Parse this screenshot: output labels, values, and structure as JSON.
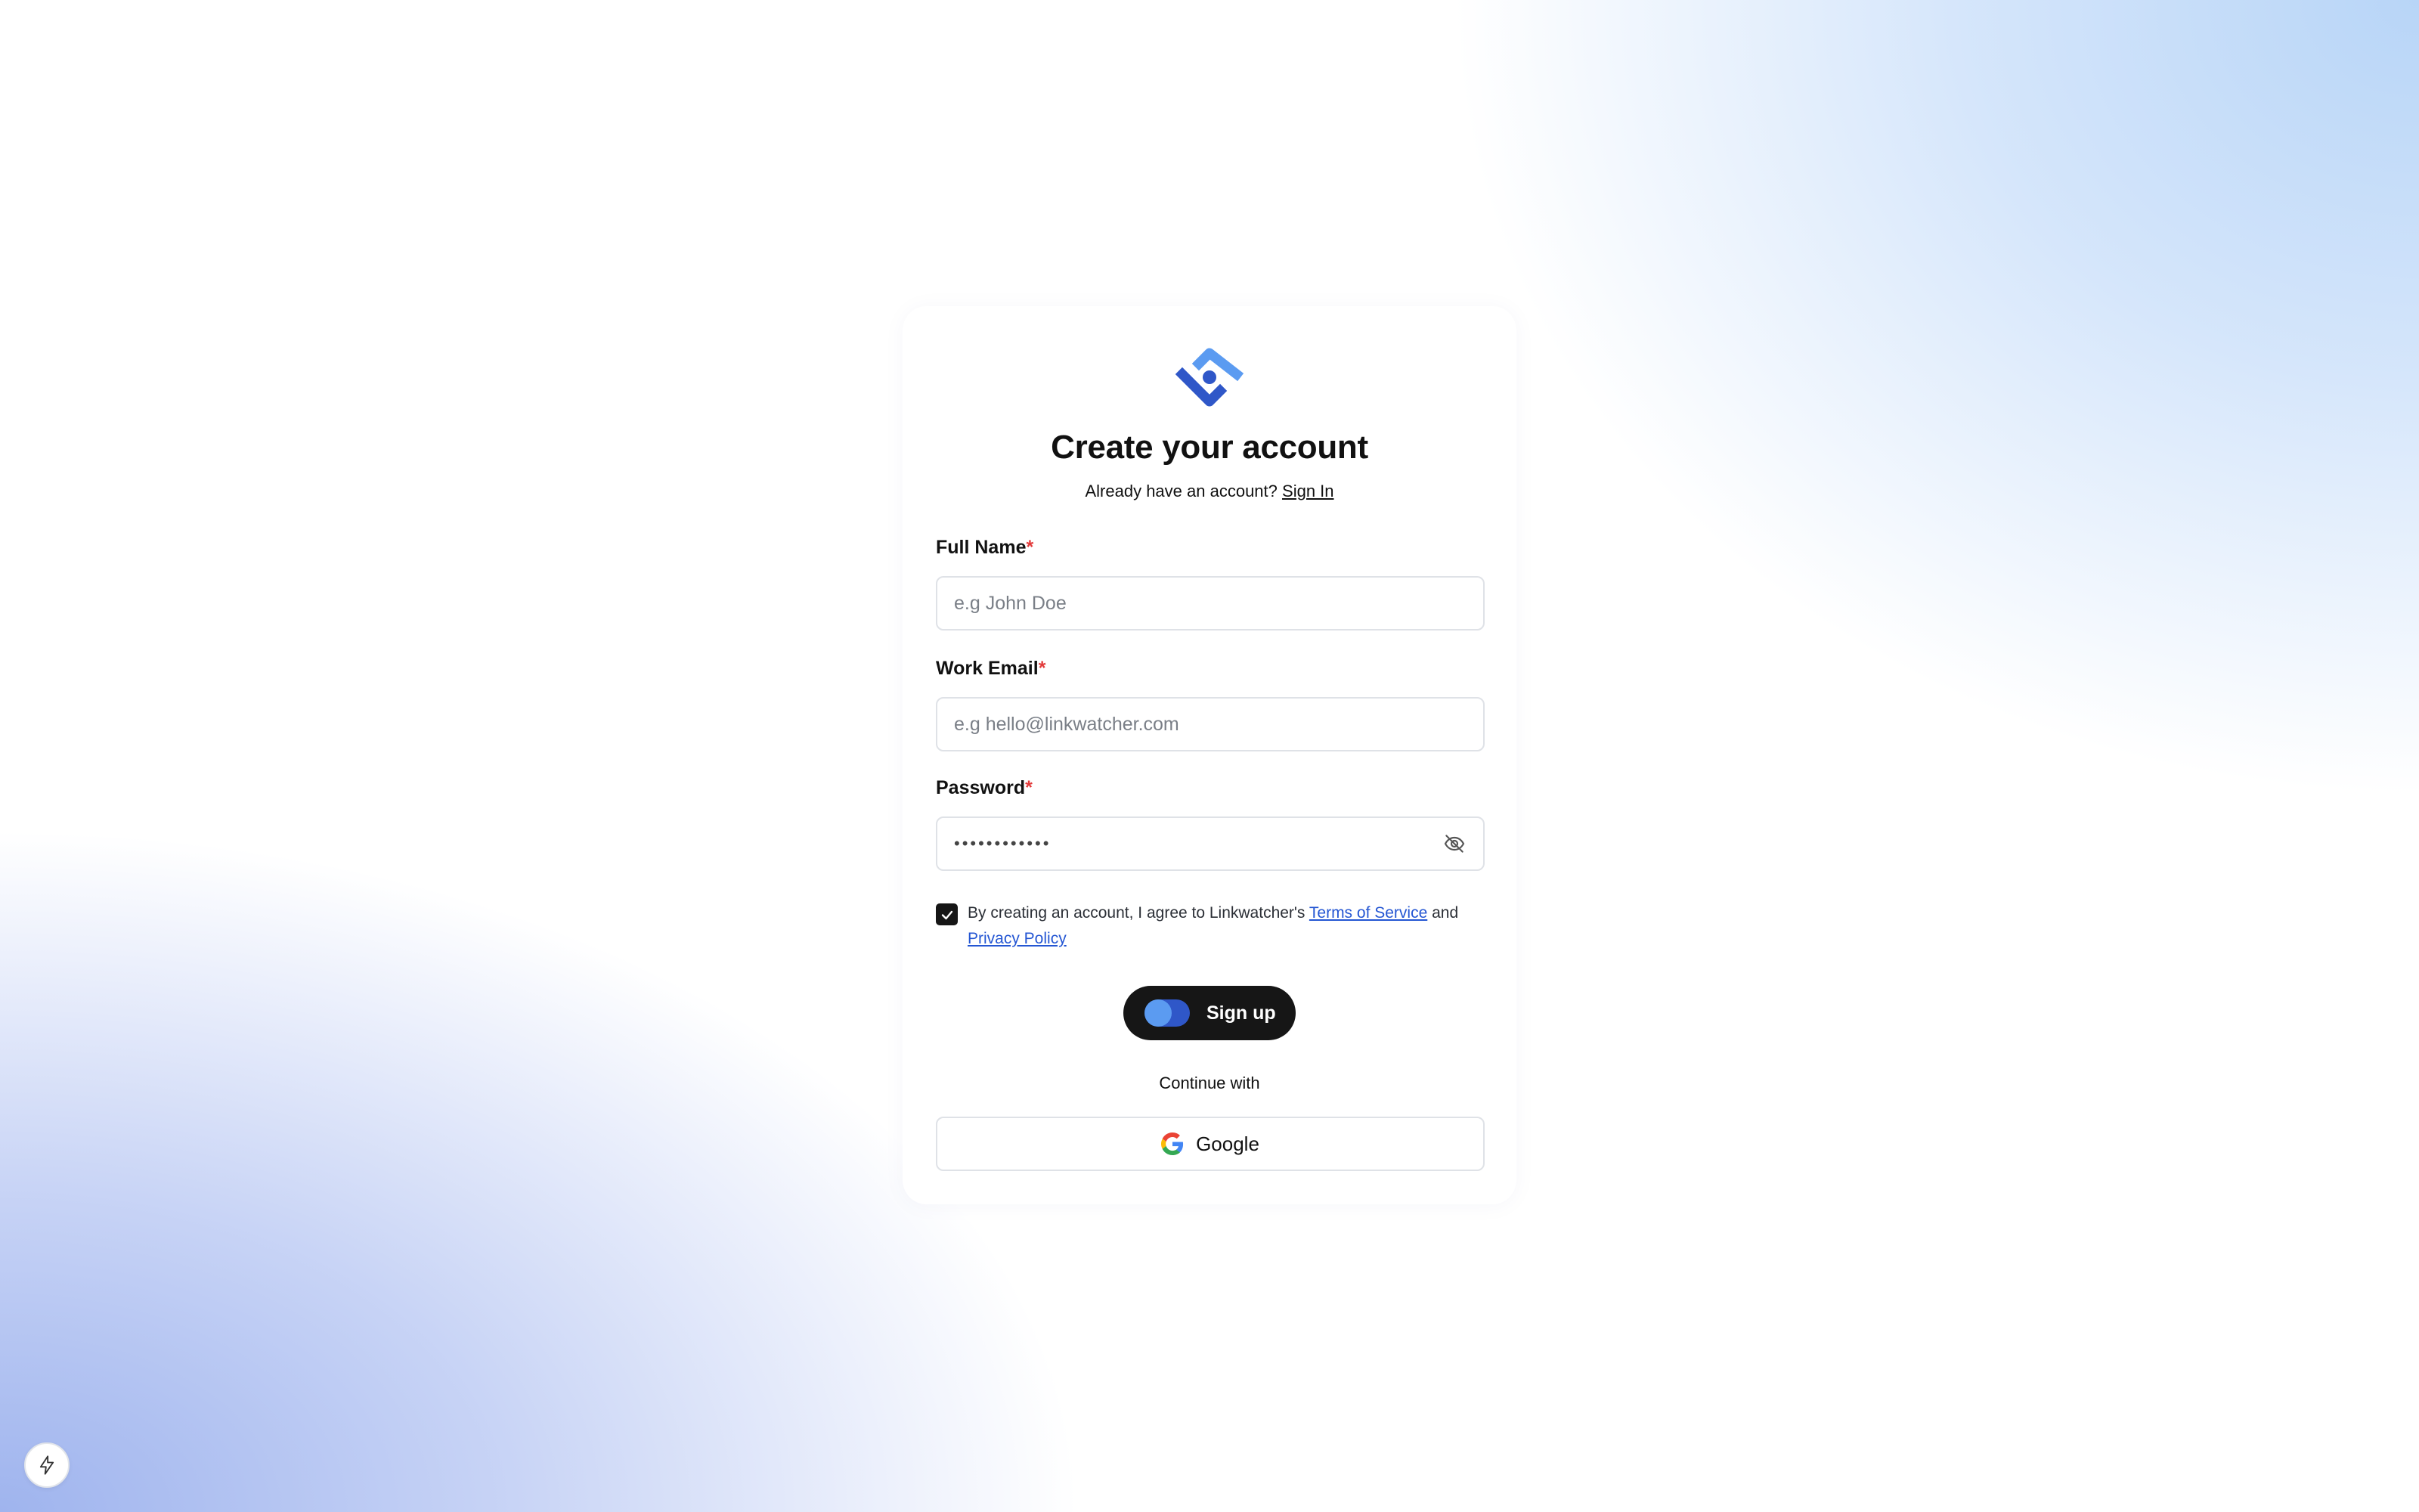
{
  "title": "Create your account",
  "subtitle": {
    "prompt": "Already have an account?",
    "link": "Sign In"
  },
  "form": {
    "full_name": {
      "label": "Full Name",
      "required_mark": "*",
      "placeholder": "e.g John Doe",
      "value": ""
    },
    "work_email": {
      "label": "Work Email",
      "required_mark": "*",
      "placeholder": "e.g hello@linkwatcher.com",
      "value": ""
    },
    "password": {
      "label": "Password",
      "required_mark": "*",
      "masked_value": "••••••••••••",
      "toggle_icon": "eye-off-icon"
    },
    "terms": {
      "checked": true,
      "text_before": "By creating an account, I agree to Linkwatcher's ",
      "tos_link": "Terms of Service",
      "text_and": " and",
      "privacy_link": "Privacy Policy"
    },
    "signup_label": "Sign up"
  },
  "continue_with": "Continue with",
  "google_label": "Google",
  "colors": {
    "accent": "#2f57c8",
    "accent_light": "#5b9bf1",
    "button_bg": "#161616",
    "required": "#e23a3a",
    "link": "#2456d3"
  }
}
